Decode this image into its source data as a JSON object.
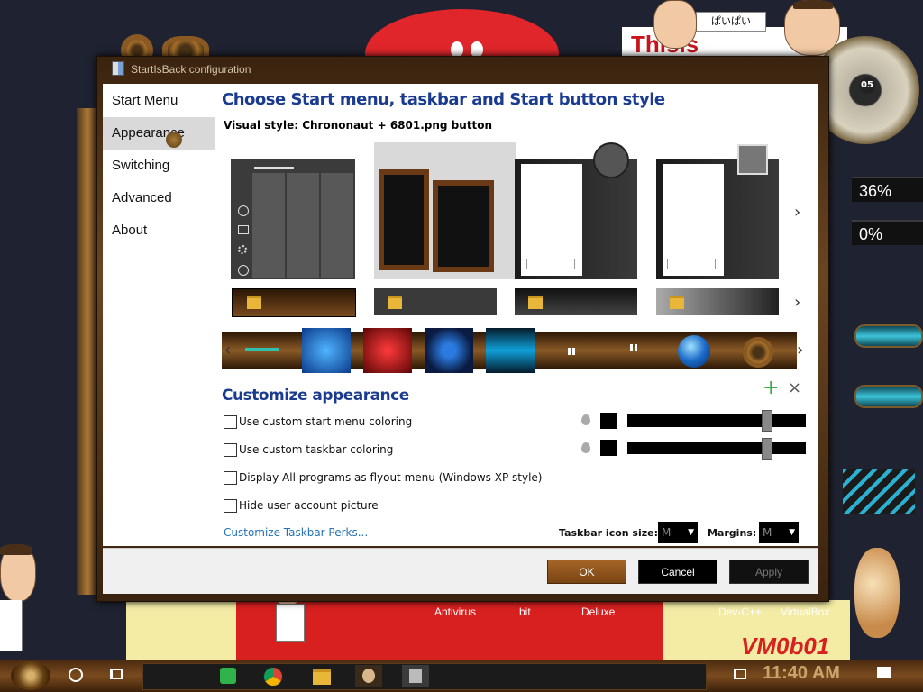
{
  "desktop": {
    "board_text": "Thisis",
    "sticky_note": "ぱいぱい",
    "clock_badge": "05",
    "gauges": [
      "36%",
      "0%"
    ],
    "icon_labels": [
      "Antivirus",
      "bit",
      "Deluxe",
      "Dev-C++",
      "VirtualBox"
    ],
    "vm_text": "VM0b01"
  },
  "window": {
    "title": "StartIsBack configuration"
  },
  "sidebar": {
    "items": [
      {
        "label": "Start Menu"
      },
      {
        "label": "Appearance"
      },
      {
        "label": "Switching"
      },
      {
        "label": "Advanced"
      },
      {
        "label": "About"
      }
    ]
  },
  "main": {
    "heading": "Choose Start menu, taskbar and Start button style",
    "visual_style": "Visual style:  Chrononaut + 6801.png button",
    "customize_heading": "Customize appearance",
    "options": [
      {
        "label": "Use custom start menu coloring",
        "checked": false
      },
      {
        "label": "Use custom taskbar coloring",
        "checked": false
      },
      {
        "label": "Display All programs as flyout menu (Windows XP style)",
        "checked": false
      },
      {
        "label": "Hide user account picture",
        "checked": false
      }
    ],
    "sliders": [
      0.78,
      0.78
    ],
    "perks_link": "Customize Taskbar Perks...",
    "icon_size_label": "Taskbar icon size:",
    "icon_size_value": "M",
    "margins_label": "Margins:",
    "margins_value": "M"
  },
  "footer": {
    "ok": "OK",
    "cancel": "Cancel",
    "apply": "Apply"
  },
  "taskbar": {
    "time": "11:40 AM"
  },
  "colors": {
    "accent_heading": "#1a3b8f",
    "link": "#2472b5",
    "ok_button": "#a56526"
  }
}
